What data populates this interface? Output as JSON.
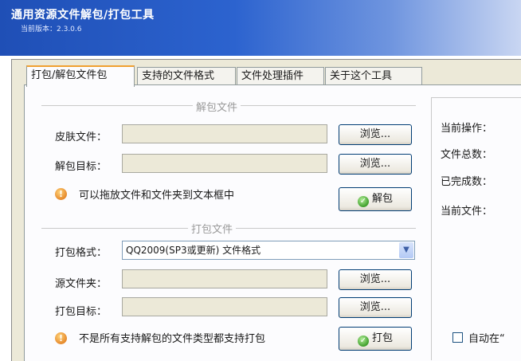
{
  "window": {
    "title": "通用资源文件解包/打包工具",
    "version": "当前版本：2.3.0.6"
  },
  "tabs": [
    {
      "label": "打包/解包文件包"
    },
    {
      "label": "支持的文件格式"
    },
    {
      "label": "文件处理插件"
    },
    {
      "label": "关于这个工具"
    }
  ],
  "unpack": {
    "section_title": "解包文件",
    "skin_file_label": "皮肤文件：",
    "skin_file_value": "",
    "target_label": "解包目标：",
    "target_value": "",
    "browse_label": "浏览...",
    "hint": "可以拖放文件和文件夹到文本框中",
    "action_label": "解包"
  },
  "pack": {
    "section_title": "打包文件",
    "format_label": "打包格式：",
    "format_value": "QQ2009(SP3或更新) 文件格式",
    "source_label": "源文件夹：",
    "source_value": "",
    "target_label": "打包目标：",
    "target_value": "",
    "browse_label": "浏览...",
    "hint": "不是所有支持解包的文件类型都支持打包",
    "action_label": "打包"
  },
  "status": {
    "current_op_label": "当前操作：",
    "total_files_label": "文件总数：",
    "done_label": "已完成数：",
    "current_file_label": "当前文件：",
    "auto_label": "自动在“"
  },
  "colors": {
    "titlebar": "#2c63cf",
    "tab_highlight": "#f0a030",
    "field_disabled": "#ece9d8"
  },
  "icons": [
    "info-icon",
    "check-circle-icon",
    "dropdown-arrow-icon"
  ]
}
